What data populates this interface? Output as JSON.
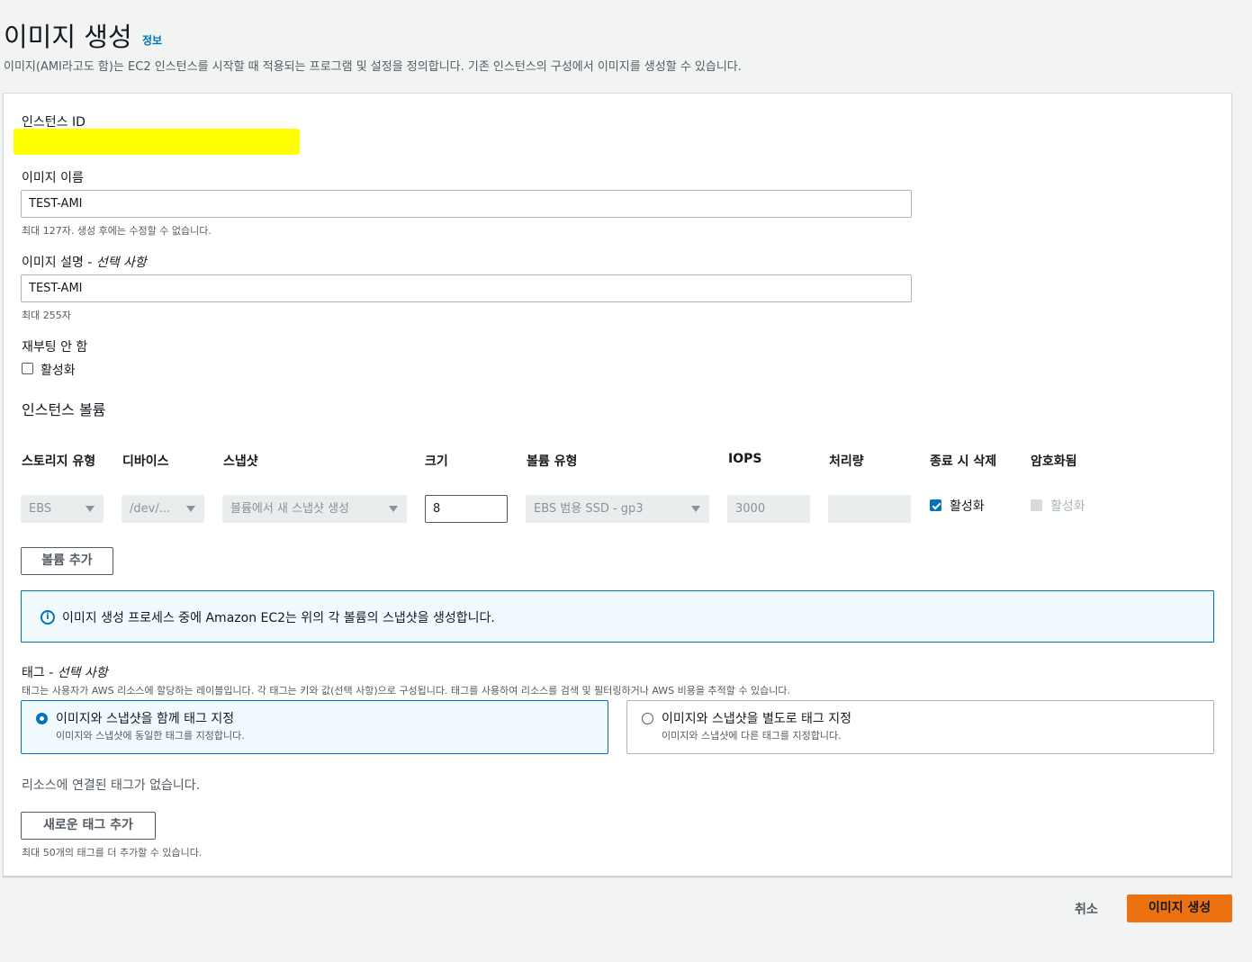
{
  "header": {
    "title": "이미지 생성",
    "info_link": "정보",
    "description": "이미지(AMI라고도 함)는 EC2 인스턴스를 시작할 때 적용되는 프로그램 및 설정을 정의합니다. 기존 인스턴스의 구성에서 이미지를 생성할 수 있습니다."
  },
  "instance": {
    "label": "인스턴스 ID"
  },
  "image_name": {
    "label": "이미지 이름",
    "value": "TEST-AMI",
    "hint": "최대 127자. 생성 후에는 수정할 수 없습니다."
  },
  "image_description": {
    "label": "이미지 설명 - ",
    "label_optional": "선택 사항",
    "value": "TEST-AMI",
    "hint": "최대 255자"
  },
  "no_reboot": {
    "label": "재부팅 안 함",
    "checkbox_label": "활성화",
    "checked": false
  },
  "volumes": {
    "title": "인스턴스 볼륨",
    "columns": [
      "스토리지 유형",
      "디바이스",
      "스냅샷",
      "크기",
      "볼륨 유형",
      "IOPS",
      "처리량",
      "종료 시 삭제",
      "암호화됨"
    ],
    "row": {
      "storage_type": "EBS",
      "device": "/dev/...",
      "snapshot": "볼륨에서 새 스냅샷 생성",
      "size": "8",
      "volume_type": "EBS 범용 SSD - gp3",
      "iops": "3000",
      "throughput": "",
      "delete_on_termination_label": "활성화",
      "encrypted_label": "활성화"
    },
    "add_button": "볼륨 추가"
  },
  "info_alert": {
    "icon": "info-icon",
    "text": "이미지 생성 프로세스 중에 Amazon EC2는 위의 각 볼륨의 스냅샷을 생성합니다."
  },
  "tags": {
    "label": "태그 - ",
    "label_optional": "선택 사항",
    "description": "태그는 사용자가 AWS 리소스에 할당하는 레이블입니다. 각 태그는 키와 값(선택 사항)으로 구성됩니다. 태그를 사용하여 리소스를 검색 및 필터링하거나 AWS 비용을 추적할 수 있습니다.",
    "options": [
      {
        "title": "이미지와 스냅샷을 함께 태그 지정",
        "desc": "이미지와 스냅샷에 동일한 태그를 지정합니다.",
        "selected": true
      },
      {
        "title": "이미지와 스냅샷을 별도로 태그 지정",
        "desc": "이미지와 스냅샷에 다른 태그를 지정합니다.",
        "selected": false
      }
    ],
    "empty_text": "리소스에 연결된 태그가 없습니다.",
    "add_button": "새로운 태그 추가",
    "hint": "최대 50개의 태그를 더 추가할 수 있습니다."
  },
  "footer": {
    "cancel": "취소",
    "submit": "이미지 생성"
  },
  "colors": {
    "primary_button": "#ec7211",
    "link": "#0073bb",
    "redaction": "#ffff00"
  }
}
